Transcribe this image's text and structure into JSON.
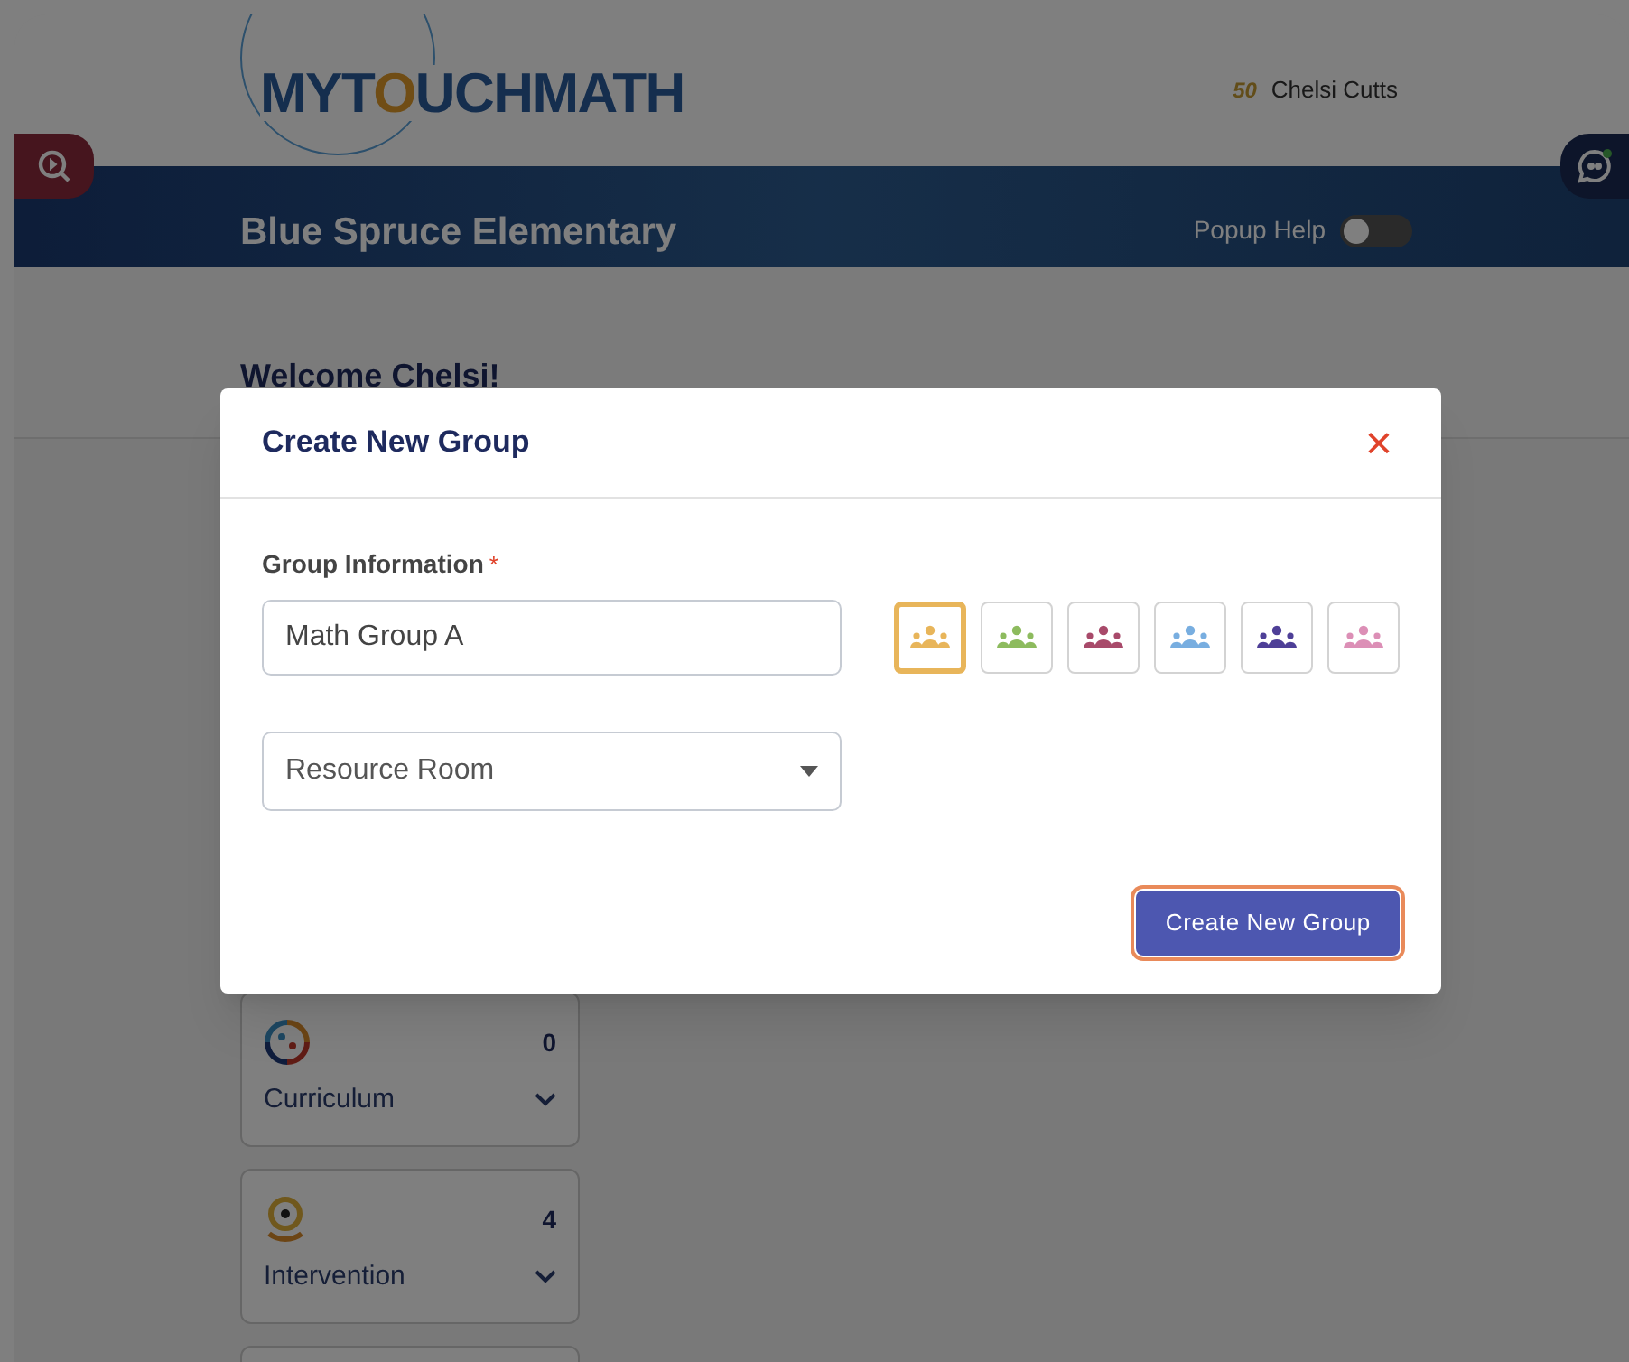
{
  "header": {
    "logo": {
      "lead": "MYT",
      "mark": "O",
      "tail": "UCHMATH"
    },
    "anniversary": "50",
    "user_name": "Chelsi Cutts",
    "school": "Blue Spruce Elementary",
    "popup_help": {
      "label": "Popup Help",
      "on": false
    }
  },
  "welcome": "Welcome Chelsi!",
  "cards": [
    {
      "kind": "curriculum",
      "count": "0",
      "label": "Curriculum"
    },
    {
      "kind": "intervention",
      "count": "4",
      "label": "Intervention"
    },
    {
      "kind": "more"
    }
  ],
  "dialog": {
    "title": "Create New Group",
    "close": "×",
    "section_label": "Group Information",
    "required_mark": "*",
    "name_value": "Math Group A",
    "room_value": "Resource Room",
    "swatches": [
      {
        "color": "#e8b55a",
        "selected": true
      },
      {
        "color": "#8dbb5e",
        "selected": false
      },
      {
        "color": "#a84a6a",
        "selected": false
      },
      {
        "color": "#78aee0",
        "selected": false
      },
      {
        "color": "#4e3f97",
        "selected": false
      },
      {
        "color": "#dc8fb6",
        "selected": false
      }
    ],
    "submit": "Create New Group"
  }
}
